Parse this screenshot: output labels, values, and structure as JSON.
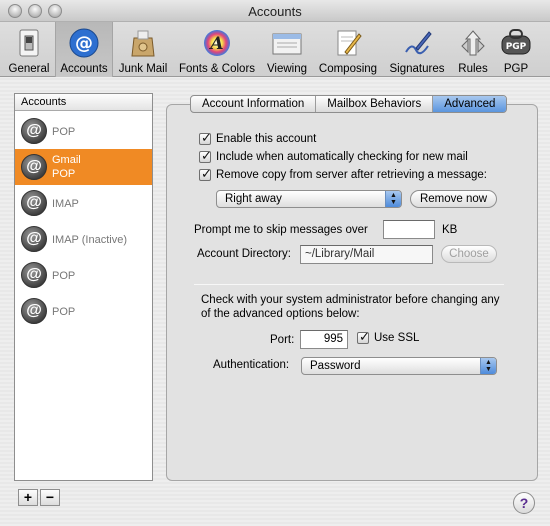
{
  "window": {
    "title": "Accounts"
  },
  "toolbar": {
    "items": [
      {
        "label": "General",
        "icon": "switch-icon"
      },
      {
        "label": "Accounts",
        "icon": "at-sign-icon"
      },
      {
        "label": "Junk Mail",
        "icon": "junk-mail-bag-icon"
      },
      {
        "label": "Fonts & Colors",
        "icon": "color-wheel-icon"
      },
      {
        "label": "Viewing",
        "icon": "mail-viewer-icon"
      },
      {
        "label": "Composing",
        "icon": "compose-pencil-icon"
      },
      {
        "label": "Signatures",
        "icon": "signature-pen-icon"
      },
      {
        "label": "Rules",
        "icon": "rules-arrows-icon"
      },
      {
        "label": "PGP",
        "icon": "pgp-icon"
      }
    ],
    "selected": "Accounts"
  },
  "sidebar": {
    "header": "Accounts",
    "accounts": [
      {
        "name": "",
        "type": "POP",
        "selected": false
      },
      {
        "name": "Gmail",
        "type": "POP",
        "selected": true
      },
      {
        "name": "",
        "type": "IMAP",
        "selected": false
      },
      {
        "name": "",
        "type": "IMAP (Inactive)",
        "selected": false
      },
      {
        "name": "",
        "type": "POP",
        "selected": false
      },
      {
        "name": "",
        "type": "POP",
        "selected": false
      }
    ],
    "add_label": "+",
    "remove_label": "−"
  },
  "tabs": [
    {
      "label": "Account Information",
      "active": false
    },
    {
      "label": "Mailbox Behaviors",
      "active": false
    },
    {
      "label": "Advanced",
      "active": true
    }
  ],
  "advanced": {
    "enable_account": {
      "label": "Enable this account",
      "checked": true
    },
    "include_checking": {
      "label": "Include when automatically checking for new mail",
      "checked": true
    },
    "remove_copy": {
      "label": "Remove copy from server after retrieving a message:",
      "checked": true
    },
    "remove_when": {
      "value": "Right away"
    },
    "remove_now_label": "Remove now",
    "skip_prompt": {
      "label": "Prompt me to skip messages over",
      "value": "",
      "unit": "KB"
    },
    "account_directory": {
      "label": "Account Directory:",
      "value": "~/Library/Mail"
    },
    "choose_label": "Choose",
    "admin_note": "Check with your system administrator before changing any of the advanced options below:",
    "port": {
      "label": "Port:",
      "value": "995"
    },
    "use_ssl": {
      "label": "Use SSL",
      "checked": true
    },
    "authentication": {
      "label": "Authentication:",
      "value": "Password"
    }
  },
  "help_label": "?",
  "colors": {
    "selection": "#f08a24",
    "tab_active": "#5b95de"
  }
}
